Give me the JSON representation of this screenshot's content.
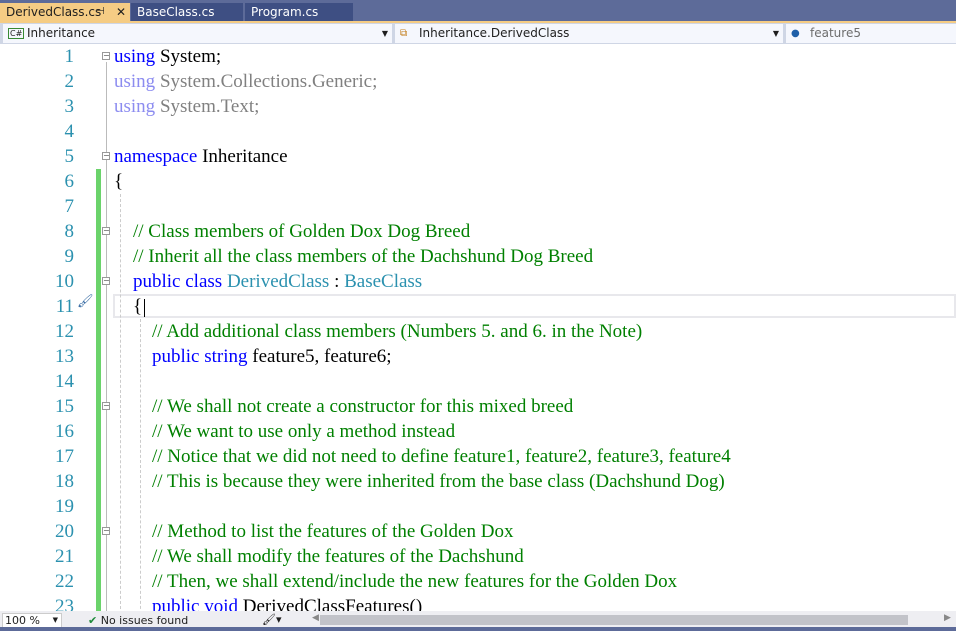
{
  "tabs": [
    {
      "label": "DerivedClass.cs",
      "active": true,
      "pin": "⊣",
      "close": "✕"
    },
    {
      "label": "BaseClass.cs"
    },
    {
      "label": "Program.cs"
    }
  ],
  "navbar": {
    "project": "Inheritance",
    "class": "Inheritance.DerivedClass",
    "member": "feature5"
  },
  "lines": [
    [
      {
        "t": "using",
        "c": "kw"
      },
      {
        "t": " System;"
      }
    ],
    [
      {
        "t": "using",
        "c": "dk"
      },
      {
        "t": " System.Collections.Generic;",
        "c": "dm"
      }
    ],
    [
      {
        "t": "using",
        "c": "dk"
      },
      {
        "t": " System.Text;",
        "c": "dm"
      }
    ],
    [],
    [
      {
        "t": "namespace",
        "c": "kw"
      },
      {
        "t": " Inheritance"
      }
    ],
    [
      {
        "t": "{"
      }
    ],
    [],
    [
      {
        "t": "    // Class members of Golden Dox Dog Breed",
        "c": "cm"
      }
    ],
    [
      {
        "t": "    // Inherit all the class members of the Dachshund Dog Breed",
        "c": "cm"
      }
    ],
    [
      {
        "t": "    "
      },
      {
        "t": "public class",
        "c": "kw"
      },
      {
        "t": " "
      },
      {
        "t": "DerivedClass",
        "c": "ty"
      },
      {
        "t": " : "
      },
      {
        "t": "BaseClass",
        "c": "ty"
      }
    ],
    [
      {
        "t": "    {"
      }
    ],
    [
      {
        "t": "        // Add additional class members (Numbers 5. and 6. in the Note)",
        "c": "cm"
      }
    ],
    [
      {
        "t": "        "
      },
      {
        "t": "public string",
        "c": "kw"
      },
      {
        "t": " feature5, feature6;"
      }
    ],
    [],
    [
      {
        "t": "        // We shall not create a constructor for this mixed breed",
        "c": "cm"
      }
    ],
    [
      {
        "t": "        // We want to use only a method instead",
        "c": "cm"
      }
    ],
    [
      {
        "t": "        // Notice that we did not need to define feature1, feature2, feature3, feature4",
        "c": "cm"
      }
    ],
    [
      {
        "t": "        // This is because they were inherited from the base class (Dachshund Dog)",
        "c": "cm"
      }
    ],
    [],
    [
      {
        "t": "        // Method to list the features of the Golden Dox",
        "c": "cm"
      }
    ],
    [
      {
        "t": "        // We shall modify the features of the Dachshund",
        "c": "cm"
      }
    ],
    [
      {
        "t": "        // Then, we shall extend/include the new features for the Golden Dox",
        "c": "cm"
      }
    ],
    [
      {
        "t": "        "
      },
      {
        "t": "public void",
        "c": "kw"
      },
      {
        "t": " DerivedClassFeatures()"
      }
    ]
  ],
  "status": {
    "zoom": "100 %",
    "issues": "No issues found"
  }
}
